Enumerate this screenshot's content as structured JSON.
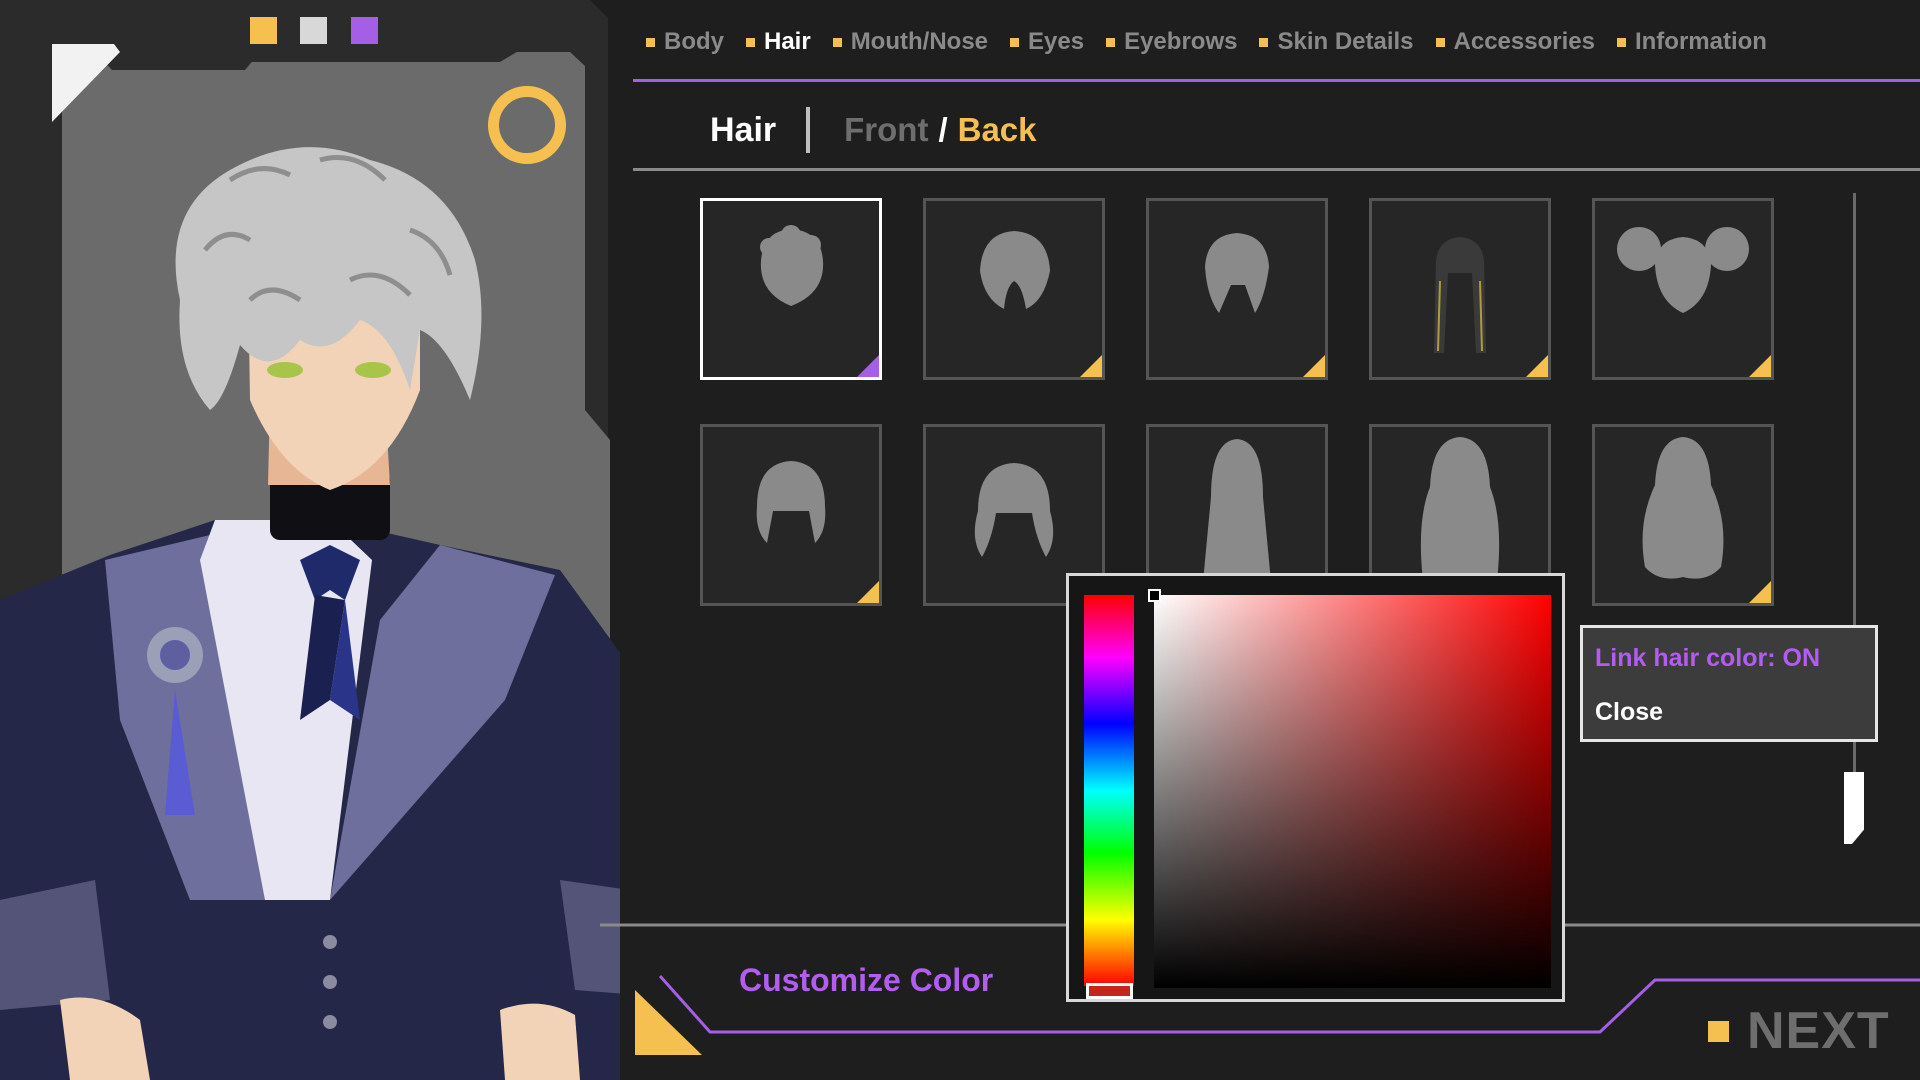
{
  "swatches": [
    {
      "name": "yellow",
      "color": "#f5c04f"
    },
    {
      "name": "light-gray",
      "color": "#d8d8d8"
    },
    {
      "name": "purple",
      "color": "#a55ee6"
    }
  ],
  "nav": {
    "items": [
      {
        "label": "Body",
        "active": false
      },
      {
        "label": "Hair",
        "active": true
      },
      {
        "label": "Mouth/Nose",
        "active": false
      },
      {
        "label": "Eyes",
        "active": false
      },
      {
        "label": "Eyebrows",
        "active": false
      },
      {
        "label": "Skin Details",
        "active": false
      },
      {
        "label": "Accessories",
        "active": false
      },
      {
        "label": "Information",
        "active": false
      }
    ]
  },
  "sub_header": {
    "title": "Hair",
    "front": "Front",
    "separator": "/",
    "back": "Back",
    "active_view": "Back"
  },
  "hair_grid": {
    "selected_index": 0,
    "tiles": [
      {
        "style": "short-curly"
      },
      {
        "style": "short-wavy"
      },
      {
        "style": "short-straight"
      },
      {
        "style": "long-braids"
      },
      {
        "style": "twin-curly-buns"
      },
      {
        "style": "bob"
      },
      {
        "style": "flared-medium"
      },
      {
        "style": "long-straight"
      },
      {
        "style": "long-curly"
      },
      {
        "style": "long-wavy"
      }
    ]
  },
  "color_picker": {
    "hue": "#ff0000",
    "selected_hue_swatch": "#c4251d"
  },
  "context_menu": {
    "link_label": "Link hair color: ON",
    "close_label": "Close"
  },
  "bottom": {
    "customize_label": "Customize Color",
    "next_label": "NEXT"
  },
  "colors": {
    "accent_yellow": "#f5c04f",
    "accent_purple": "#a55ee6",
    "panel_gray": "#6b6b6b",
    "background": "#1e1e1e"
  }
}
